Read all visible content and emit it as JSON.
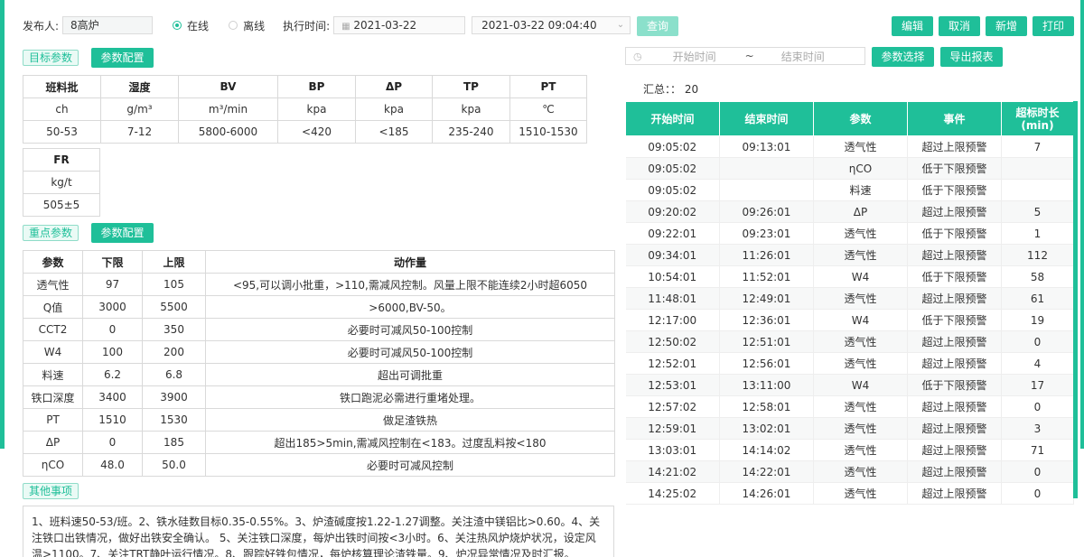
{
  "topbar": {
    "publisher_label": "发布人:",
    "publisher_value": "8高炉",
    "online": "在线",
    "offline": "离线",
    "exec_time_label": "执行时间:",
    "date_value": "2021-03-22",
    "datetime_value": "2021-03-22 09:04:40",
    "query": "查询",
    "edit": "编辑",
    "cancel": "取消",
    "add": "新增",
    "print": "打印"
  },
  "target": {
    "tag": "目标参数",
    "config": "参数配置",
    "headers": [
      "班料批",
      "湿度",
      "BV",
      "BP",
      "ΔP",
      "TP",
      "PT"
    ],
    "units": [
      "ch",
      "g/m³",
      "m³/min",
      "kpa",
      "kpa",
      "kpa",
      "℃"
    ],
    "values": [
      "50-53",
      "7-12",
      "5800-6000",
      "<420",
      "<185",
      "235-240",
      "1510-1530"
    ],
    "extra_header": "FR",
    "extra_unit": "kg/t",
    "extra_value": "505±5"
  },
  "key": {
    "tag": "重点参数",
    "config": "参数配置",
    "headers": [
      "参数",
      "下限",
      "上限",
      "动作量"
    ],
    "rows": [
      [
        "透气性",
        "97",
        "105",
        "<95,可以调小批重，>110,需减风控制。风量上限不能连续2小时超6050"
      ],
      [
        "Q值",
        "3000",
        "5500",
        ">6000,BV-50。"
      ],
      [
        "CCT2",
        "0",
        "350",
        "必要时可减风50-100控制"
      ],
      [
        "W4",
        "100",
        "200",
        "必要时可减风50-100控制"
      ],
      [
        "料速",
        "6.2",
        "6.8",
        "超出可调批重"
      ],
      [
        "铁口深度",
        "3400",
        "3900",
        "铁口跑泥必需进行重堵处理。"
      ],
      [
        "PT",
        "1510",
        "1530",
        "做足渣铁热"
      ],
      [
        "ΔP",
        "0",
        "185",
        "超出185>5min,需减风控制在<183。过度乱料按<180"
      ],
      [
        "ηCO",
        "48.0",
        "50.0",
        "必要时可减风控制"
      ]
    ]
  },
  "other": {
    "tag": "其他事项",
    "text": "1、班料速50-53/班。2、铁水硅数目标0.35-0.55%。3、炉渣碱度按1.22-1.27调整。关注渣中镁铝比>0.60。4、关注铁口出铁情况，做好出铁安全确认。 5、关注铁口深度，每炉出铁时间按<3小时。6、关注热风炉烧炉状况，设定风温>1100。7、关注TRT静叶运行情况。8、跟踪好铁包情况，每炉核算理论渣铁量。9、炉况异常情况及时汇报。"
  },
  "events": {
    "start_placeholder": "开始时间",
    "tilde": "~",
    "end_placeholder": "结束时间",
    "param_select": "参数选择",
    "export": "导出报表",
    "summary": "汇总：：  20",
    "headers": [
      "开始时间",
      "结束时间",
      "参数",
      "事件",
      "超标时长(min)"
    ],
    "rows": [
      [
        "09:05:02",
        "09:13:01",
        "透气性",
        "超过上限预警",
        "7"
      ],
      [
        "09:05:02",
        "",
        "ηCO",
        "低于下限预警",
        ""
      ],
      [
        "09:05:02",
        "",
        "料速",
        "低于下限预警",
        ""
      ],
      [
        "09:20:02",
        "09:26:01",
        "ΔP",
        "超过上限预警",
        "5"
      ],
      [
        "09:22:01",
        "09:23:01",
        "透气性",
        "低于下限预警",
        "1"
      ],
      [
        "09:34:01",
        "11:26:01",
        "透气性",
        "超过上限预警",
        "112"
      ],
      [
        "10:54:01",
        "11:52:01",
        "W4",
        "低于下限预警",
        "58"
      ],
      [
        "11:48:01",
        "12:49:01",
        "透气性",
        "超过上限预警",
        "61"
      ],
      [
        "12:17:00",
        "12:36:01",
        "W4",
        "低于下限预警",
        "19"
      ],
      [
        "12:50:02",
        "12:51:01",
        "透气性",
        "超过上限预警",
        "0"
      ],
      [
        "12:52:01",
        "12:56:01",
        "透气性",
        "超过上限预警",
        "4"
      ],
      [
        "12:53:01",
        "13:11:00",
        "W4",
        "低于下限预警",
        "17"
      ],
      [
        "12:57:02",
        "12:58:01",
        "透气性",
        "超过上限预警",
        "0"
      ],
      [
        "12:59:01",
        "13:02:01",
        "透气性",
        "超过上限预警",
        "3"
      ],
      [
        "13:03:01",
        "14:14:02",
        "透气性",
        "超过上限预警",
        "71"
      ],
      [
        "14:21:02",
        "14:22:01",
        "透气性",
        "超过上限预警",
        "0"
      ],
      [
        "14:25:02",
        "14:26:01",
        "透气性",
        "超过上限预警",
        "0"
      ]
    ]
  }
}
